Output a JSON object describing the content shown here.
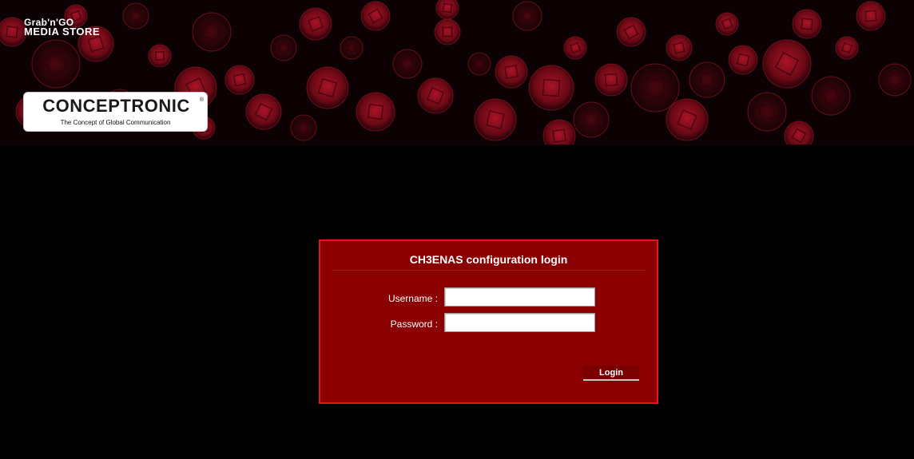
{
  "header": {
    "brand_line1": "Grab'n'GO",
    "brand_line2": "MEDIA STORE",
    "logo_name": "CONCEPTRONIC",
    "logo_registered": "®",
    "logo_tagline": "The Concept of Global Communication"
  },
  "login": {
    "title": "CH3ENAS configuration login",
    "username_label": "Username :",
    "password_label": "Password :",
    "username_value": "",
    "password_value": "",
    "submit_label": "Login"
  },
  "colors": {
    "page_background": "#000000",
    "banner_background": "#0c0204",
    "panel_background": "#8b0000",
    "panel_border": "#e8141a",
    "button_background": "#7a0000"
  }
}
